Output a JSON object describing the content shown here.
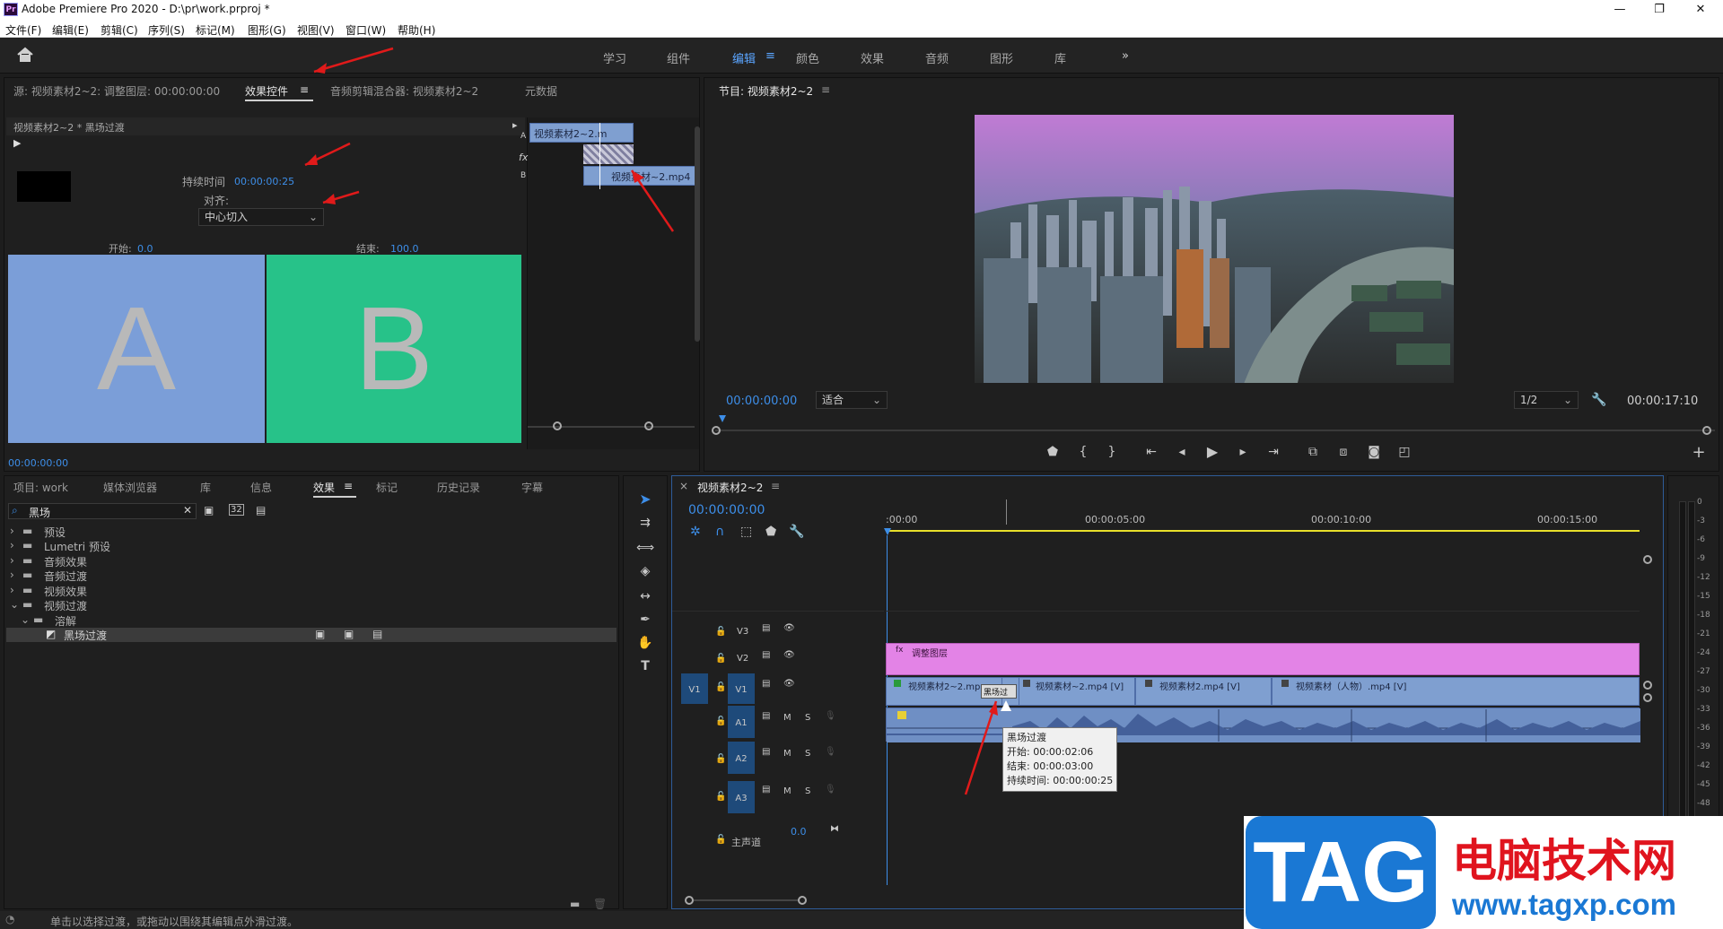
{
  "window": {
    "app_icon": "Pr",
    "title": "Adobe Premiere Pro 2020 - D:\\pr\\work.prproj *",
    "minimize": "—",
    "restore": "❐",
    "close": "✕"
  },
  "menu": [
    "文件(F)",
    "编辑(E)",
    "剪辑(C)",
    "序列(S)",
    "标记(M)",
    "图形(G)",
    "视图(V)",
    "窗口(W)",
    "帮助(H)"
  ],
  "workspaces": {
    "items": [
      "学习",
      "组件",
      "编辑",
      "颜色",
      "效果",
      "音频",
      "图形",
      "库"
    ],
    "active": "编辑",
    "more": "»",
    "menu_glyph": "≡"
  },
  "source_panel": {
    "tabs": [
      "源: 视频素材2~2: 调整图层: 00:00:00:00",
      "效果控件",
      "音频剪辑混合器: 视频素材2~2",
      "元数据"
    ],
    "active_tab": "效果控件",
    "clip_path": "视频素材2~2 * 黑场过渡",
    "duration_label": "持续时间",
    "duration_value": "00:00:00:25",
    "align_label": "对齐:",
    "align_value": "中心切入",
    "start_label": "开始:",
    "start_value": "0.0",
    "end_label": "结束:",
    "end_value": "100.0",
    "preview_a": "A",
    "preview_b": "B",
    "timecode": "00:00:00:00",
    "mini_track_a": "A",
    "mini_track_fx": "fx",
    "mini_track_b": "B",
    "mini_clip_a": "视频素材2~2.m",
    "mini_clip_b": "视频素材~2.mp4"
  },
  "program_panel": {
    "title": "节目: 视频素材2~2",
    "menu_glyph": "≡",
    "timecode": "00:00:00:00",
    "fit_label": "适合",
    "resolution": "1/2",
    "duration": "00:00:17:10",
    "controls": [
      "marker-icon",
      "in-point-icon",
      "out-point-icon",
      "go-to-in-icon",
      "step-back-icon",
      "play-icon",
      "step-forward-icon",
      "go-to-out-icon",
      "lift-icon",
      "extract-icon",
      "export-frame-icon",
      "compare-icon"
    ]
  },
  "project_panel": {
    "tabs": [
      "项目: work",
      "媒体浏览器",
      "库",
      "信息",
      "效果",
      "标记",
      "历史记录",
      "字幕"
    ],
    "active_tab": "效果",
    "search_value": "黑场",
    "tree": [
      {
        "label": "预设",
        "expanded": false,
        "indent": 0
      },
      {
        "label": "Lumetri 预设",
        "expanded": false,
        "indent": 0
      },
      {
        "label": "音频效果",
        "expanded": false,
        "indent": 0
      },
      {
        "label": "音频过渡",
        "expanded": false,
        "indent": 0
      },
      {
        "label": "视频效果",
        "expanded": false,
        "indent": 0
      },
      {
        "label": "视频过渡",
        "expanded": true,
        "indent": 0
      },
      {
        "label": "溶解",
        "expanded": true,
        "indent": 1
      },
      {
        "label": "黑场过渡",
        "expanded": false,
        "indent": 2,
        "selected": true
      }
    ]
  },
  "timeline": {
    "close": "×",
    "sequence_name": "视频素材2~2",
    "menu_glyph": "≡",
    "timecode": "00:00:00:00",
    "ruler": [
      ":00:00",
      "00:00:05:00",
      "00:00:10:00",
      "00:00:15:00"
    ],
    "tracks": {
      "v3": "V3",
      "v2": "V2",
      "v1": "V1",
      "v1_source": "V1",
      "a1": "A1",
      "a2": "A2",
      "a3": "A3",
      "mute": "M",
      "solo": "S",
      "master": "主声道",
      "master_value": "0.0"
    },
    "clips_v2": [
      {
        "label": "调整图层"
      }
    ],
    "clips_v1": [
      "视频素材2~2.mp",
      "视频素材~2.mp4 [V]",
      "视频素材2.mp4 [V]",
      "视频素材（人物）.mp4 [V]"
    ],
    "transition_label": "黑场过",
    "tooltip": {
      "name": "黑场过渡",
      "start": "开始: 00:00:02:06",
      "end": "结束: 00:00:03:00",
      "duration": "持续时间: 00:00:00:25"
    }
  },
  "meter": {
    "scale": [
      "0",
      "-3",
      "-6",
      "-9",
      "-12",
      "-15",
      "-18",
      "-21",
      "-24",
      "-27",
      "-30",
      "-33",
      "-36",
      "-39",
      "-42",
      "-45",
      "-48"
    ]
  },
  "status_bar": {
    "text": "单击以选择过渡，或拖动以围绕其编辑点外滑过渡。"
  },
  "watermark": {
    "logo": "TAG",
    "site_name": "电脑技术网",
    "url": "www.tagxp.com"
  },
  "colors": {
    "accent_blue": "#3d8ee8",
    "clip_blue": "#7f9fd0",
    "clip_pink": "#e383e6",
    "preview_a": "#7b9ed8",
    "preview_b": "#27c289",
    "annotation_red": "#e01a1a"
  }
}
